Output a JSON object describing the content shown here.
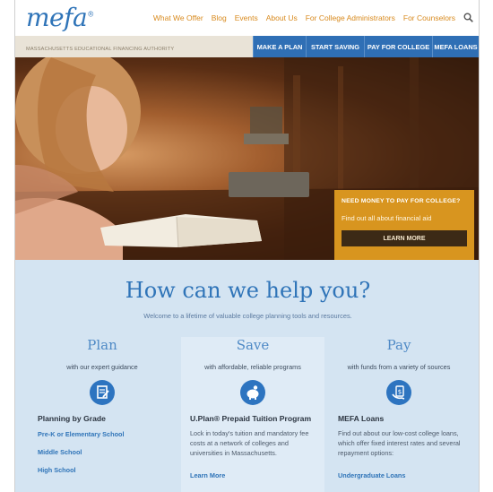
{
  "header": {
    "logo_text": "mefa",
    "logo_mark": "®",
    "tagline": "MASSACHUSETTS EDUCATIONAL FINANCING AUTHORITY",
    "top_nav": [
      "What We Offer",
      "Blog",
      "Events",
      "About Us",
      "For College Administrators",
      "For Counselors"
    ],
    "search_icon": "search-icon",
    "main_nav": [
      "MAKE A PLAN",
      "START SAVING",
      "PAY FOR COLLEGE",
      "MEFA LOANS"
    ]
  },
  "hero": {
    "cta_heading": "NEED MONEY TO PAY FOR COLLEGE?",
    "cta_text": "Find out all about financial aid",
    "cta_button": "LEARN MORE"
  },
  "help": {
    "title": "How can we help you?",
    "subtitle": "Welcome to a lifetime of valuable college planning tools and resources.",
    "columns": [
      {
        "title": "Plan",
        "subtitle": "with our expert guidance",
        "icon": "checklist-icon",
        "heading": "Planning by Grade",
        "links": [
          "Pre-K or Elementary School",
          "Middle School",
          "High School"
        ]
      },
      {
        "title": "Save",
        "subtitle": "with affordable, reliable programs",
        "icon": "piggy-bank-icon",
        "heading": "U.Plan® Prepaid Tuition Program",
        "text": "Lock in today's tuition and mandatory fee costs at a network of colleges and universities in Massachusetts.",
        "link": "Learn More"
      },
      {
        "title": "Pay",
        "subtitle": "with funds from a variety of sources",
        "icon": "money-icon",
        "heading": "MEFA Loans",
        "text": "Find out about our low-cost college loans, which offer fixed interest rates and several repayment options:",
        "link": "Undergraduate Loans"
      }
    ]
  },
  "colors": {
    "brand_blue": "#2f74b8",
    "nav_blue": "#2f6fb5",
    "accent_orange": "#d8951f",
    "help_bg": "#d4e4f2"
  }
}
